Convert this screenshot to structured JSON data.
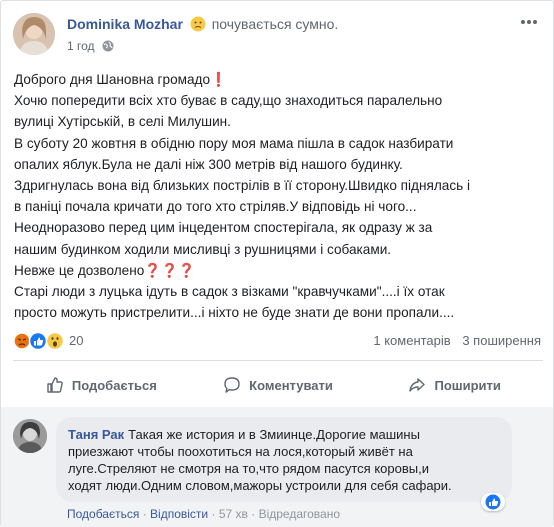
{
  "post": {
    "author": "Dominika Mozhar",
    "feeling": "почувається сумно.",
    "time": "1 год",
    "paragraph_lines": [
      "Доброго дня Шановна громадо❗",
      "Хочю попередити всіх хто буває в саду,що знаходиться паралельно",
      "вулиці Хутірській, в селі Милушин.",
      "В суботу 20 жовтня в обідню пору моя мама пішла в садок назбирати",
      "опалих яблук.Була не далі ніж 300 метрів від нашого будинку.",
      "Здригнулась вона від близьких пострілів в її сторону.Швидко піднялась і",
      "в паніці почала кричати до того хто стріляв.У відповідь ні чого...",
      "Неодноразово перед цим інцедентом спостерігала, як одразу ж за",
      "нашим будинком ходили мисливці з рушницями і собаками.",
      "Невже це дозволено❓❓❓",
      "Старі люди з луцька ідуть в садок з візками \"кравчучками\"....і їх отак",
      "просто можуть пристрелити...і ніхто не буде знати де вони пропали...."
    ]
  },
  "reactions": {
    "icons": [
      "angry-reaction",
      "like-reaction",
      "wow-reaction"
    ],
    "count": "20",
    "comments": "1 коментарів",
    "shares": "3 поширення"
  },
  "actions": {
    "like": "Подобається",
    "comment": "Коментувати",
    "share": "Поширити"
  },
  "comment": {
    "author": "Таня Рак",
    "lines": [
      "Такая же история и в Змиинце.Дорогие машины",
      "приезжают чтобы поохотиться на лося,который живёт на",
      "луге.Стреляют не смотря на то,что рядом пасутся коровы,и",
      "ходят люди.Одним словом,мажоры устроили для себя сафари."
    ],
    "like_label": "Подобається",
    "reply_label": "Відповісти",
    "time": "57 хв",
    "edited": "Відредаговано",
    "separator": "·"
  },
  "colors": {
    "link": "#385898",
    "muted": "#616770",
    "like_blue": "#1877f2",
    "angry": "#e9710f"
  }
}
